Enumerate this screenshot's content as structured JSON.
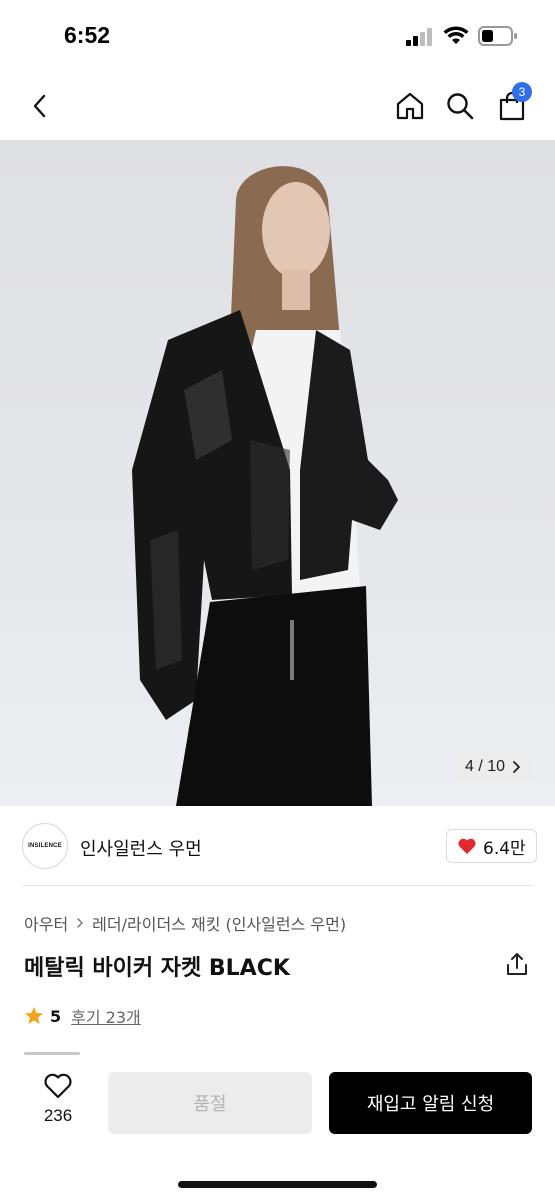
{
  "status_bar": {
    "time": "6:52"
  },
  "nav": {
    "cart_count": "3"
  },
  "gallery": {
    "counter": "4 / 10"
  },
  "brand": {
    "logo_text": "INSILENCE",
    "name": "인사일런스 우먼"
  },
  "likes": {
    "count": "6.4만"
  },
  "breadcrumb": {
    "items": [
      "아우터",
      "레더/라이더스 재킷 (인사일런스 우먼)"
    ]
  },
  "product": {
    "title": "메탈릭 바이커 자켓 BLACK"
  },
  "rating": {
    "score": "5",
    "reviews_label": "후기 23개"
  },
  "bottom_bar": {
    "wish_count": "236",
    "soldout_label": "품절",
    "restock_label": "재입고 알림 신청"
  },
  "colors": {
    "accent": "#2f6fe8",
    "heart": "#e0282e",
    "star": "#f4a41c",
    "cta": "#000000"
  }
}
